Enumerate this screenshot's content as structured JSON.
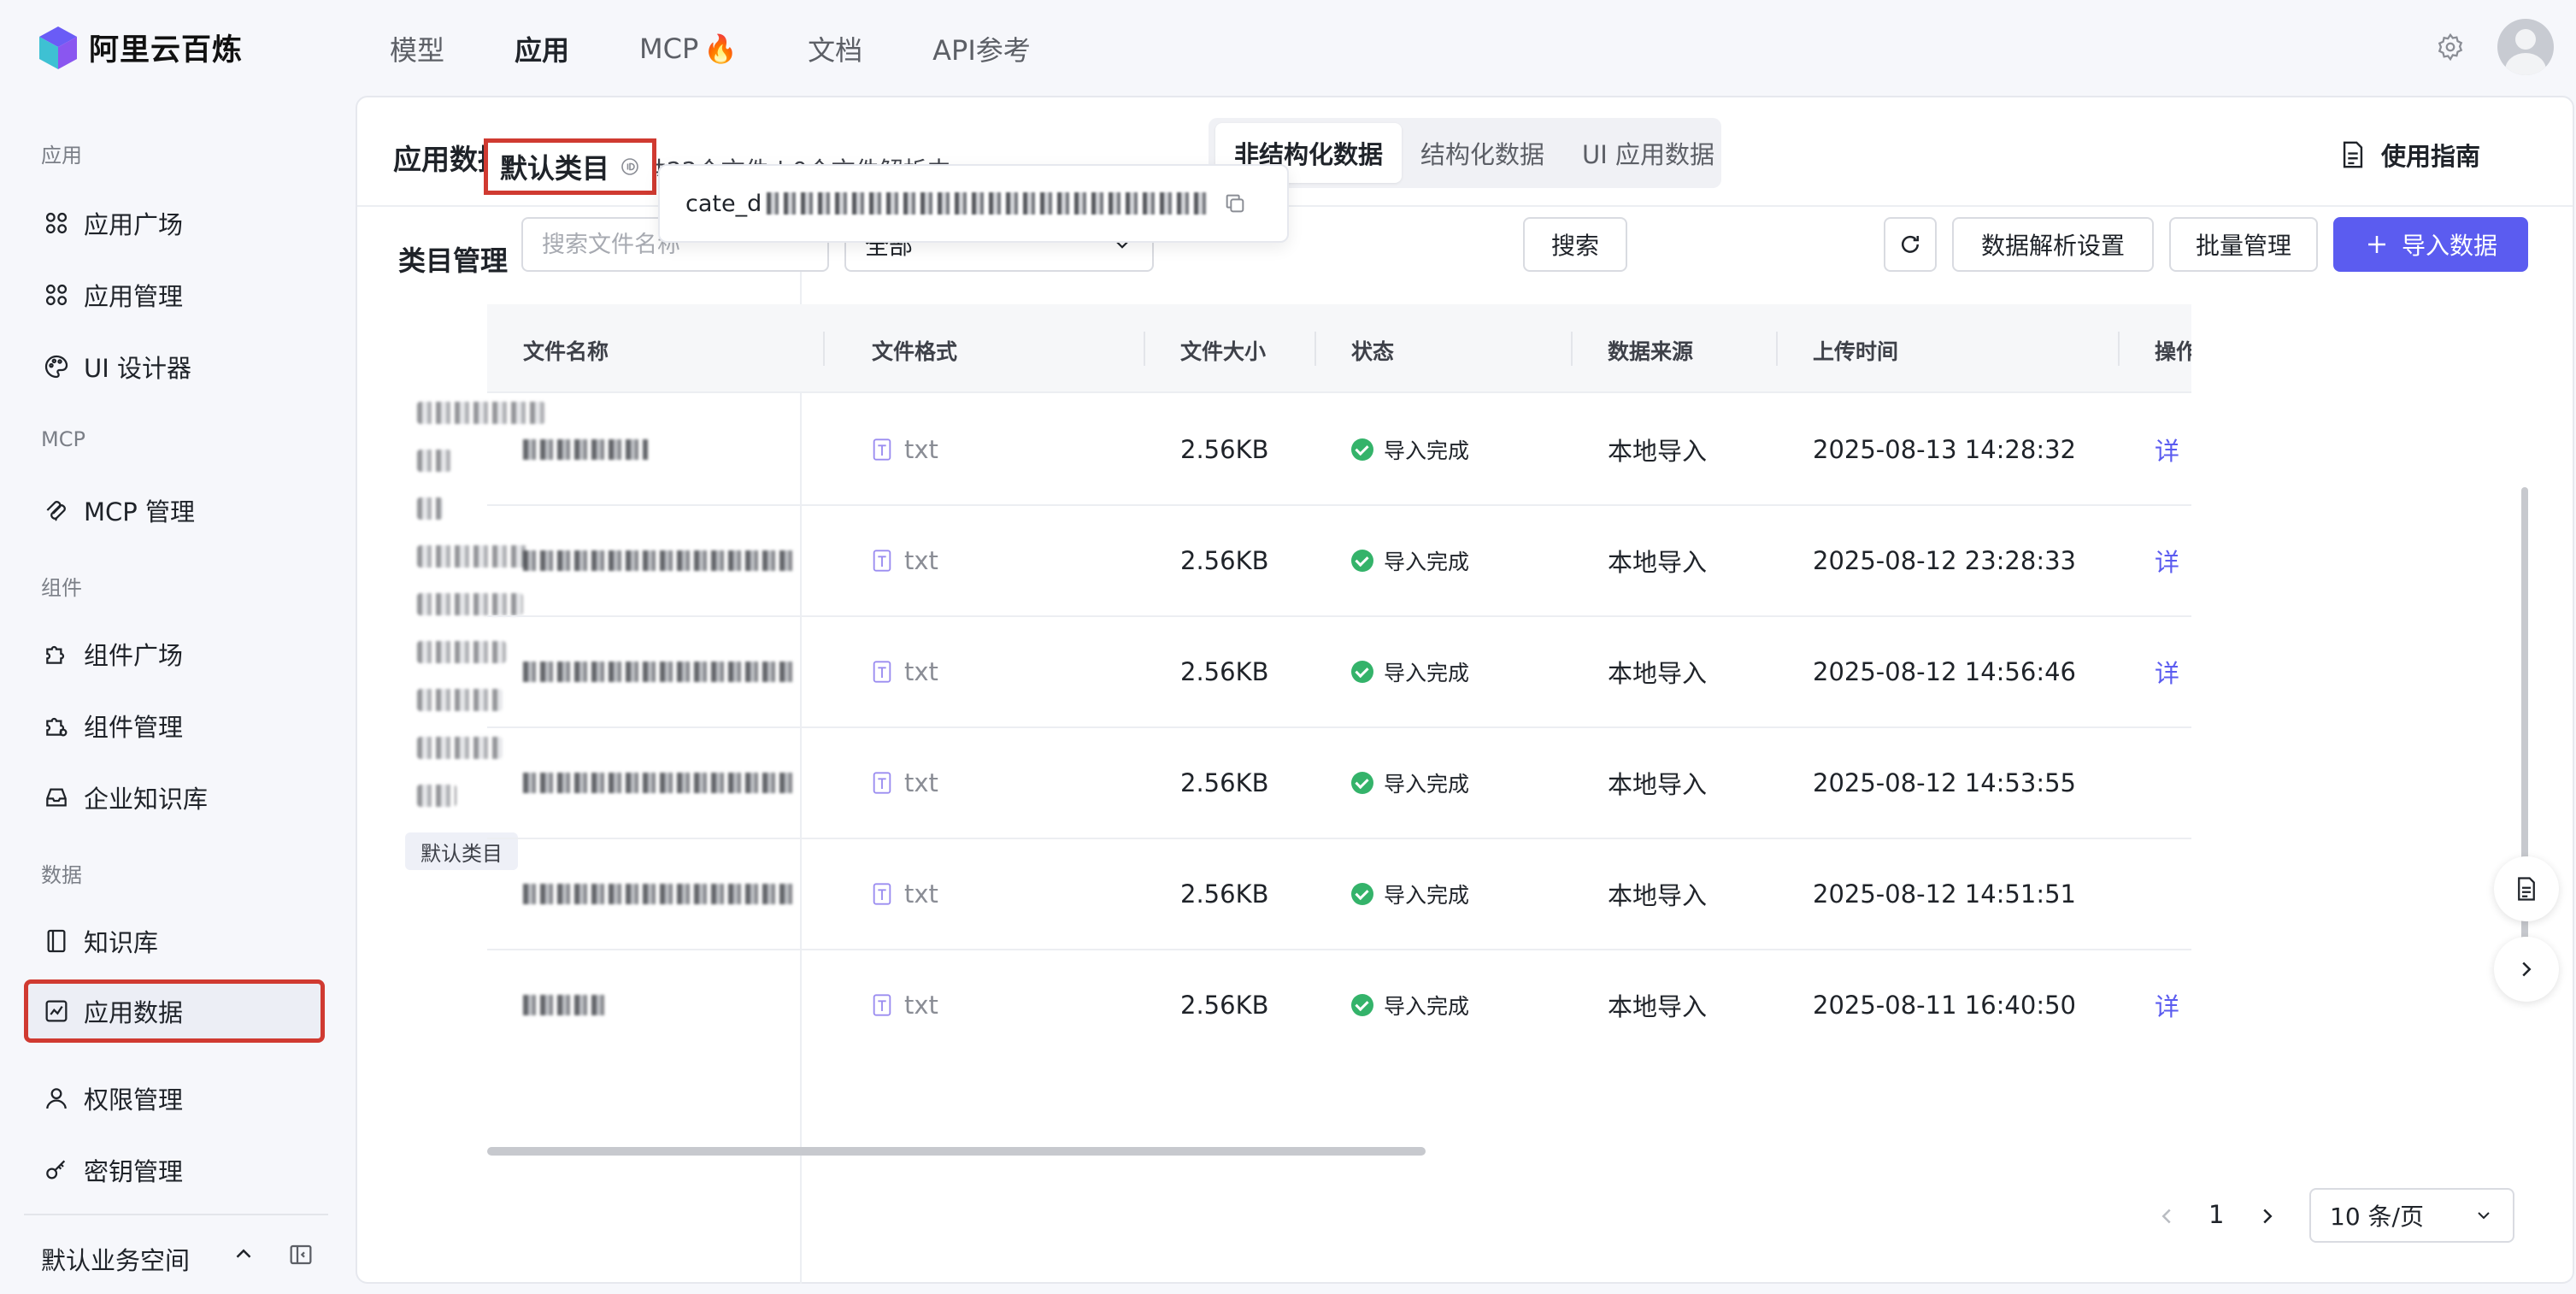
{
  "app": {
    "name": "阿里云百炼"
  },
  "topnav": {
    "items": [
      {
        "label": "模型",
        "active": false
      },
      {
        "label": "应用",
        "active": true
      },
      {
        "label": "MCP",
        "active": false,
        "badge": "🔥"
      },
      {
        "label": "文档",
        "active": false
      },
      {
        "label": "API参考",
        "active": false
      }
    ]
  },
  "sidebar": {
    "sections": {
      "app": "应用",
      "mcp": "MCP",
      "component": "组件",
      "data": "数据"
    },
    "items": [
      {
        "label": "应用广场",
        "icon": "grid-icon"
      },
      {
        "label": "应用管理",
        "icon": "grid-icon"
      },
      {
        "label": "UI 设计器",
        "icon": "palette-icon"
      },
      {
        "label": "MCP 管理",
        "icon": "mcp-icon"
      },
      {
        "label": "组件广场",
        "icon": "puzzle-icon"
      },
      {
        "label": "组件管理",
        "icon": "puzzle-gear-icon"
      },
      {
        "label": "企业知识库",
        "icon": "inbox-icon"
      },
      {
        "label": "知识库",
        "icon": "book-icon"
      },
      {
        "label": "应用数据",
        "icon": "chart-icon",
        "active": true
      },
      {
        "label": "权限管理",
        "icon": "user-icon"
      },
      {
        "label": "密钥管理",
        "icon": "key-icon"
      }
    ],
    "workspace": "默认业务空间"
  },
  "main": {
    "title": "应用数据",
    "tabs": [
      {
        "label": "非结构化数据",
        "active": true
      },
      {
        "label": "结构化数据",
        "active": false
      },
      {
        "label": "UI 应用数据",
        "active": false
      }
    ],
    "guide": "使用指南"
  },
  "category": {
    "title": "类目管理",
    "default_chip": "默认类目",
    "tooltip_prefix": "cate_d"
  },
  "content": {
    "category_name": "默认类目",
    "stats": "共22个文件  |  0个文件解析中",
    "search_placeholder": "搜索文件名称",
    "filter_value": "全部",
    "search_button": "搜索",
    "parse_settings": "数据解析设置",
    "batch_manage": "批量管理",
    "import_button": "导入数据"
  },
  "table": {
    "headers": [
      "文件名称",
      "文件格式",
      "文件大小",
      "状态",
      "数据来源",
      "上传时间",
      "操作"
    ],
    "rows": [
      {
        "format": "txt",
        "size": "2.56KB",
        "status": "导入完成",
        "source": "本地导入",
        "time": "2025-08-13 14:28:32",
        "action": "详"
      },
      {
        "format": "txt",
        "size": "2.56KB",
        "status": "导入完成",
        "source": "本地导入",
        "time": "2025-08-12 23:28:33",
        "action": "详"
      },
      {
        "format": "txt",
        "size": "2.56KB",
        "status": "导入完成",
        "source": "本地导入",
        "time": "2025-08-12 14:56:46",
        "action": "详"
      },
      {
        "format": "txt",
        "size": "2.56KB",
        "status": "导入完成",
        "source": "本地导入",
        "time": "2025-08-12 14:53:55",
        "action": ""
      },
      {
        "format": "txt",
        "size": "2.56KB",
        "status": "导入完成",
        "source": "本地导入",
        "time": "2025-08-12 14:51:51",
        "action": ""
      },
      {
        "format": "txt",
        "size": "2.56KB",
        "status": "导入完成",
        "source": "本地导入",
        "time": "2025-08-11 16:40:50",
        "action": "详"
      }
    ]
  },
  "pagination": {
    "page": "1",
    "page_size": "10 条/页"
  },
  "colors": {
    "accent": "#5b5cf0",
    "highlight": "#d03a31",
    "success": "#34b36a"
  }
}
